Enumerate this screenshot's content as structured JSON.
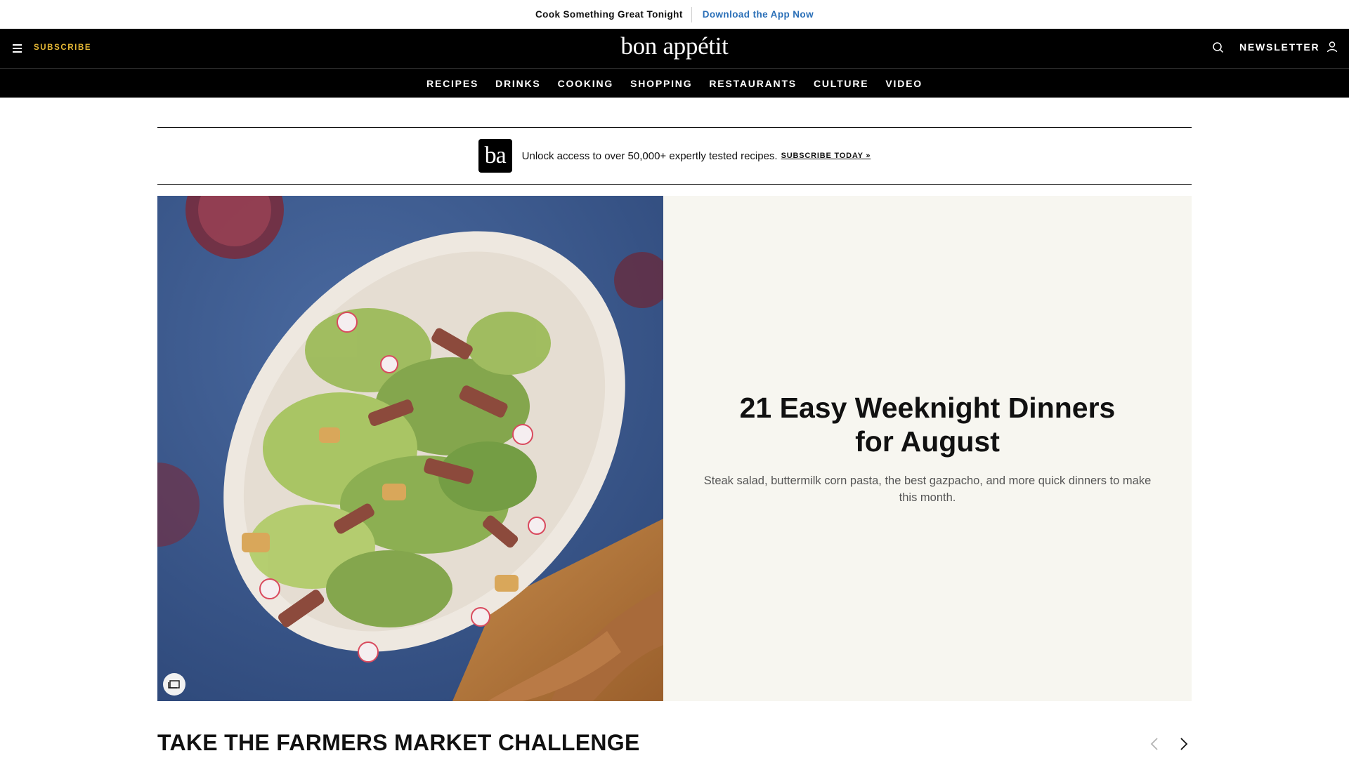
{
  "promo_strip": {
    "text": "Cook Something Great Tonight",
    "link": "Download the App Now"
  },
  "header": {
    "menu_icon": "hamburger-menu-icon",
    "subscribe": "SUBSCRIBE",
    "logo": "bon appétit",
    "search_icon": "search-icon",
    "newsletter": "NEWSLETTER",
    "account_icon": "account-icon"
  },
  "nav": {
    "items": [
      "RECIPES",
      "DRINKS",
      "COOKING",
      "SHOPPING",
      "RESTAURANTS",
      "CULTURE",
      "VIDEO"
    ]
  },
  "banner": {
    "logo": "ba",
    "text": "Unlock access to over 50,000+ expertly tested recipes.",
    "cta": "SUBSCRIBE TODAY »"
  },
  "hero": {
    "title": "21 Easy Weeknight Dinners for August",
    "dek": "Steak salad, buttermilk corn pasta, the best gazpacho, and more quick dinners to make this month.",
    "gallery_icon": "gallery-icon"
  },
  "section": {
    "title": "TAKE THE FARMERS MARKET CHALLENGE",
    "prev_icon": "chevron-left-icon",
    "next_icon": "chevron-right-icon"
  },
  "colors": {
    "header_bg": "#000000",
    "subscribe": "#e5b835",
    "promo_link": "#2a6fb7",
    "hero_panel_bg": "#f7f6f0"
  }
}
